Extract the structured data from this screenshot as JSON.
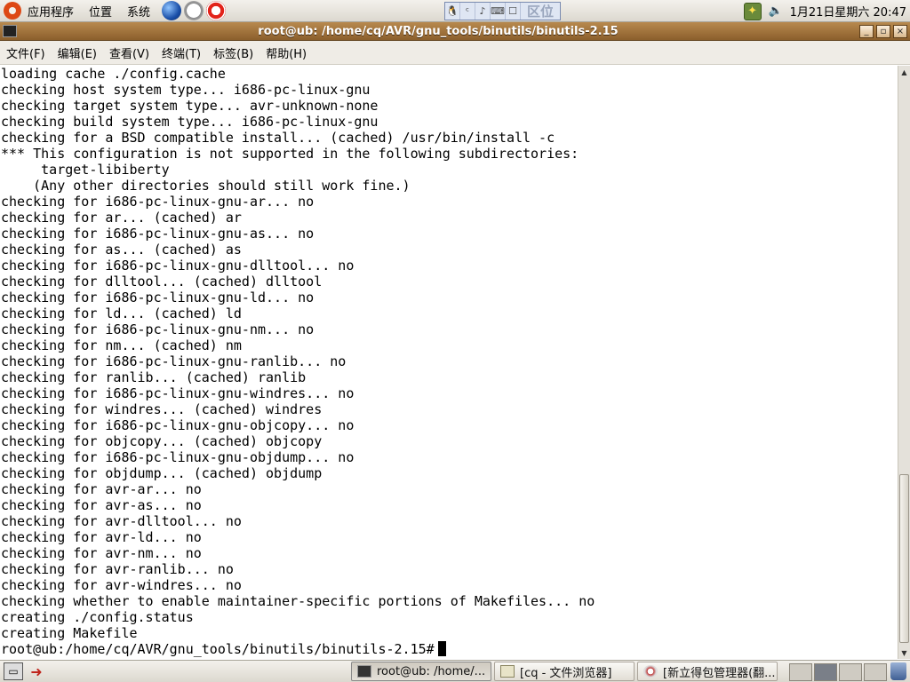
{
  "top_panel": {
    "menus": [
      "应用程序",
      "位置",
      "系统"
    ],
    "launchers": [
      "globe-icon",
      "clock-icon",
      "lifebuoy-icon"
    ],
    "ime": {
      "cells": [
        "🐧",
        "ᶜ",
        "♪",
        "⌨",
        "☐"
      ],
      "text": "区位"
    },
    "clock": "1月21日星期六 20:47"
  },
  "window": {
    "title": "root@ub: /home/cq/AVR/gnu_tools/binutils/binutils-2.15",
    "menu": [
      "文件(F)",
      "编辑(E)",
      "查看(V)",
      "终端(T)",
      "标签(B)",
      "帮助(H)"
    ],
    "controls": {
      "minimize": "_",
      "maximize": "▫",
      "close": "×"
    }
  },
  "terminal": {
    "lines": [
      "loading cache ./config.cache",
      "checking host system type... i686-pc-linux-gnu",
      "checking target system type... avr-unknown-none",
      "checking build system type... i686-pc-linux-gnu",
      "checking for a BSD compatible install... (cached) /usr/bin/install -c",
      "*** This configuration is not supported in the following subdirectories:",
      "     target-libiberty",
      "    (Any other directories should still work fine.)",
      "checking for i686-pc-linux-gnu-ar... no",
      "checking for ar... (cached) ar",
      "checking for i686-pc-linux-gnu-as... no",
      "checking for as... (cached) as",
      "checking for i686-pc-linux-gnu-dlltool... no",
      "checking for dlltool... (cached) dlltool",
      "checking for i686-pc-linux-gnu-ld... no",
      "checking for ld... (cached) ld",
      "checking for i686-pc-linux-gnu-nm... no",
      "checking for nm... (cached) nm",
      "checking for i686-pc-linux-gnu-ranlib... no",
      "checking for ranlib... (cached) ranlib",
      "checking for i686-pc-linux-gnu-windres... no",
      "checking for windres... (cached) windres",
      "checking for i686-pc-linux-gnu-objcopy... no",
      "checking for objcopy... (cached) objcopy",
      "checking for i686-pc-linux-gnu-objdump... no",
      "checking for objdump... (cached) objdump",
      "checking for avr-ar... no",
      "checking for avr-as... no",
      "checking for avr-dlltool... no",
      "checking for avr-ld... no",
      "checking for avr-nm... no",
      "checking for avr-ranlib... no",
      "checking for avr-windres... no",
      "checking whether to enable maintainer-specific portions of Makefiles... no",
      "creating ./config.status",
      "creating Makefile"
    ],
    "prompt": "root@ub:/home/cq/AVR/gnu_tools/binutils/binutils-2.15#"
  },
  "taskbar": {
    "tasks": [
      {
        "label": "root@ub: /home/...",
        "icon": "terminal-icon",
        "active": true
      },
      {
        "label": "[cq - 文件浏览器]",
        "icon": "folder-icon",
        "active": false
      },
      {
        "label": "[新立得包管理器(翻...",
        "icon": "package-icon",
        "active": false
      }
    ]
  },
  "colors": {
    "titlebar": "#8b5f2c",
    "terminal_bg": "#ffffff",
    "terminal_fg": "#000000",
    "panel": "#e6e3dc"
  }
}
